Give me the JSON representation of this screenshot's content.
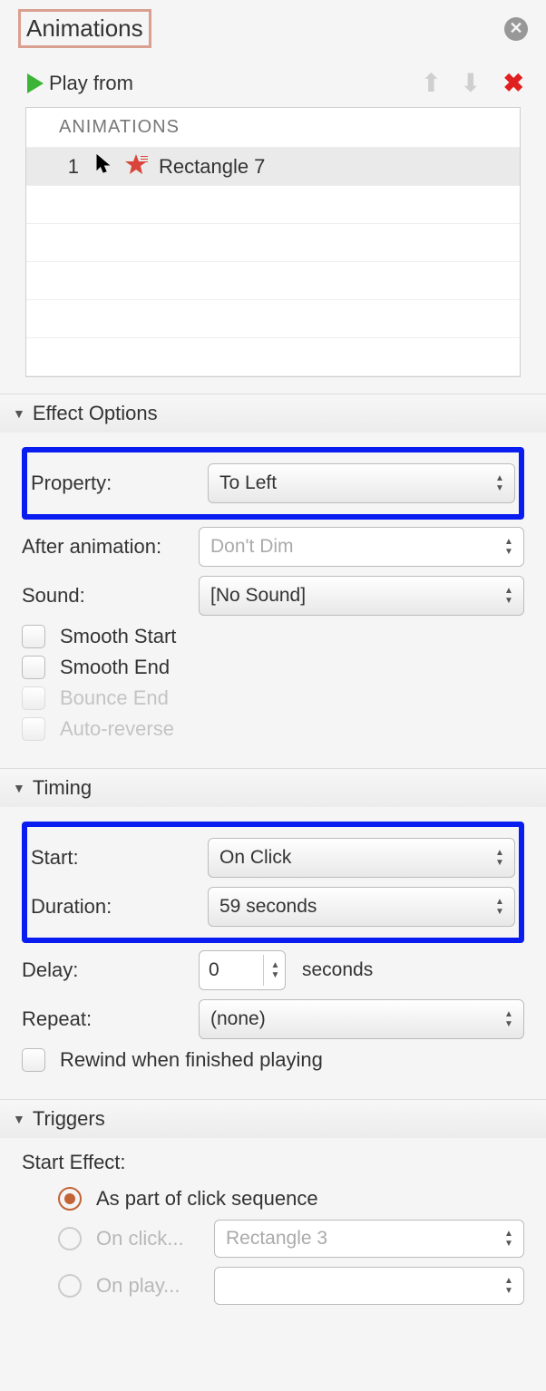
{
  "header": {
    "title": "Animations"
  },
  "toolbar": {
    "play_label": "Play from"
  },
  "list": {
    "header": "ANIMATIONS",
    "item_number": "1",
    "item_name": "Rectangle 7"
  },
  "effect": {
    "section": "Effect Options",
    "property_label": "Property:",
    "property_value": "To Left",
    "after_label": "After animation:",
    "after_value": "Don't Dim",
    "sound_label": "Sound:",
    "sound_value": "[No Sound]",
    "smooth_start": "Smooth Start",
    "smooth_end": "Smooth End",
    "bounce_end": "Bounce End",
    "auto_reverse": "Auto-reverse"
  },
  "timing": {
    "section": "Timing",
    "start_label": "Start:",
    "start_value": "On Click",
    "duration_label": "Duration:",
    "duration_value": "59 seconds",
    "delay_label": "Delay:",
    "delay_value": "0",
    "delay_unit": "seconds",
    "repeat_label": "Repeat:",
    "repeat_value": "(none)",
    "rewind": "Rewind when finished playing"
  },
  "triggers": {
    "section": "Triggers",
    "start_effect": "Start Effect:",
    "opt_sequence": "As part of click sequence",
    "opt_onclick": "On click...",
    "onclick_target": "Rectangle 3",
    "opt_onplay": "On play..."
  }
}
